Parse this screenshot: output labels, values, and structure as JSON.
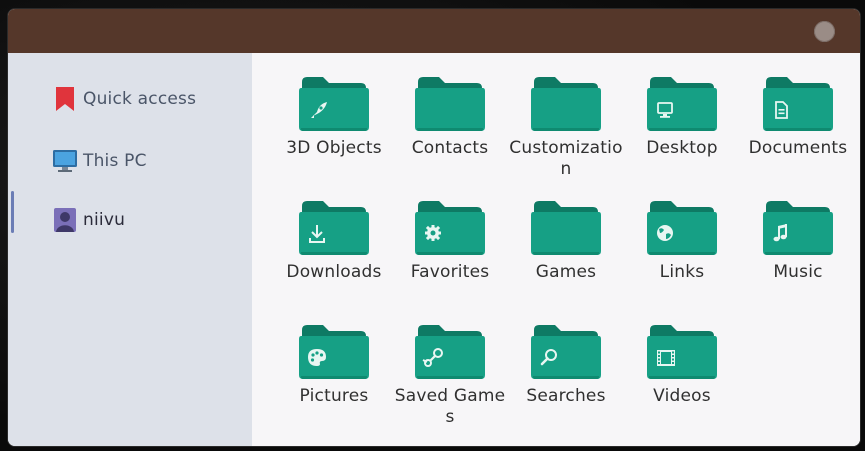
{
  "window": {
    "close_icon": "close-circle-icon"
  },
  "sidebar": {
    "items": [
      {
        "label": "Quick access",
        "icon": "bookmark-icon"
      },
      {
        "label": "This PC",
        "icon": "monitor-icon"
      },
      {
        "label": "niivu",
        "icon": "user-icon",
        "selected": true
      }
    ]
  },
  "folders": [
    {
      "label": "3D Objects",
      "icon": "rocket-icon"
    },
    {
      "label": "Contacts",
      "icon": "none"
    },
    {
      "label": "Customization",
      "icon": "none"
    },
    {
      "label": "Desktop",
      "icon": "desktop-icon"
    },
    {
      "label": "Documents",
      "icon": "document-icon"
    },
    {
      "label": "Downloads",
      "icon": "download-icon"
    },
    {
      "label": "Favorites",
      "icon": "gear-icon"
    },
    {
      "label": "Games",
      "icon": "none"
    },
    {
      "label": "Links",
      "icon": "globe-icon"
    },
    {
      "label": "Music",
      "icon": "music-note-icon"
    },
    {
      "label": "Pictures",
      "icon": "palette-icon"
    },
    {
      "label": "Saved Games",
      "icon": "steam-icon"
    },
    {
      "label": "Searches",
      "icon": "magnifier-icon"
    },
    {
      "label": "Videos",
      "icon": "film-icon"
    }
  ],
  "colors": {
    "titlebar": "#55372a",
    "sidebar": "#dde1e9",
    "folder_front": "#16a085",
    "folder_back": "#0e7a64",
    "accent": "#6b7db5"
  }
}
